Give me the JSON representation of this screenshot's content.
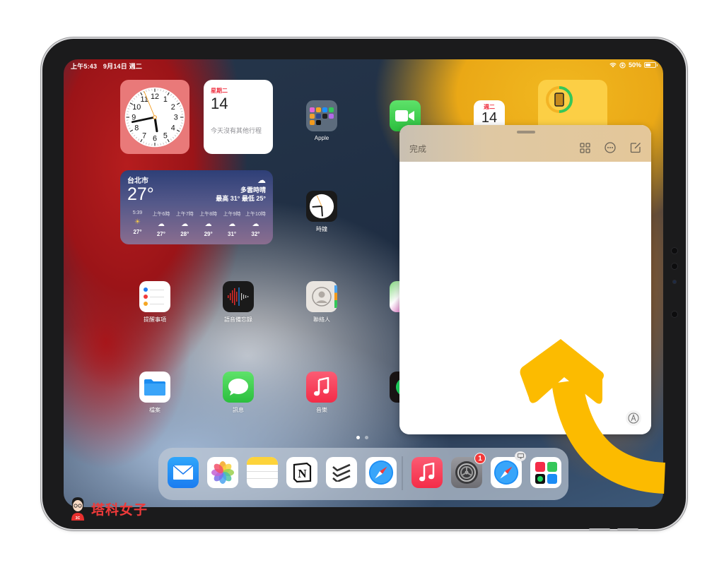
{
  "status_bar": {
    "time": "上午5:43",
    "date": "9月14日 週二",
    "battery_percent": "50%",
    "battery_level": 0.5,
    "icons": [
      "wifi-icon",
      "screen-rotation-lock-icon",
      "battery-icon"
    ]
  },
  "widgets": {
    "clock": {
      "name": "clock-widget",
      "hour": 5,
      "minute": 43
    },
    "calendar": {
      "weekday": "星期二",
      "date": "14",
      "note": "今天沒有其他行程"
    },
    "weather": {
      "city": "台北市",
      "temperature": "27°",
      "condition": "多雲時晴",
      "high_low": "最高 31° 最低 25°",
      "hourly": [
        {
          "time": "5:39",
          "icon": "sunrise-icon",
          "temp": "27°"
        },
        {
          "time": "上午6時",
          "icon": "cloud-icon",
          "temp": "27°"
        },
        {
          "time": "上午7時",
          "icon": "cloud-icon",
          "temp": "28°"
        },
        {
          "time": "上午8時",
          "icon": "cloud-icon",
          "temp": "29°"
        },
        {
          "time": "上午9時",
          "icon": "cloud-icon",
          "temp": "31°"
        },
        {
          "time": "上午10時",
          "icon": "cloud-icon",
          "temp": "32°"
        }
      ]
    },
    "calendar_icon_partial": {
      "weekday": "週二",
      "date": "14"
    },
    "battery_widget": {
      "device": "ipad-icon",
      "level": 0.5
    }
  },
  "apps": [
    {
      "label": "Apple",
      "icon": "folder-icon"
    },
    {
      "label": "FaceTime",
      "icon": "facetime-icon",
      "visible_label": "Fac"
    },
    {
      "label": "時鐘",
      "icon": "clock-icon"
    },
    {
      "label": "提醒事項",
      "icon": "reminders-icon"
    },
    {
      "label": "語音備忘錄",
      "icon": "voice-memos-icon"
    },
    {
      "label": "聯絡人",
      "icon": "contacts-icon"
    },
    {
      "label": "檔案",
      "icon": "files-icon"
    },
    {
      "label": "訊息",
      "icon": "messages-icon"
    },
    {
      "label": "音樂",
      "icon": "music-icon"
    },
    {
      "label": "Spotify",
      "icon": "spotify-icon",
      "visible_label": "S"
    }
  ],
  "page_indicator": {
    "pages": 2,
    "current": 1
  },
  "dock": {
    "apps": [
      {
        "name": "Mail",
        "icon": "mail-icon"
      },
      {
        "name": "Photos",
        "icon": "photos-icon"
      },
      {
        "name": "Notes",
        "icon": "notes-icon"
      },
      {
        "name": "Notion",
        "icon": "notion-icon"
      },
      {
        "name": "Todoist",
        "icon": "todoist-icon"
      },
      {
        "name": "Safari",
        "icon": "safari-icon"
      },
      {
        "name": "Music",
        "icon": "music-icon"
      },
      {
        "name": "Settings",
        "icon": "settings-icon",
        "badge": "1"
      },
      {
        "name": "Safari",
        "icon": "safari-icon",
        "handoff": true
      },
      {
        "name": "App Library",
        "icon": "app-library-icon"
      }
    ]
  },
  "quick_note": {
    "done_label": "完成",
    "actions": [
      "grid-view-icon",
      "more-icon",
      "compose-icon"
    ],
    "markup_icon": "markup-icon",
    "header_color": "#e0c8a0"
  },
  "annotation": {
    "arrow_color": "#fcbb00",
    "direction": "up"
  },
  "watermark": {
    "text": "塔科女子"
  }
}
